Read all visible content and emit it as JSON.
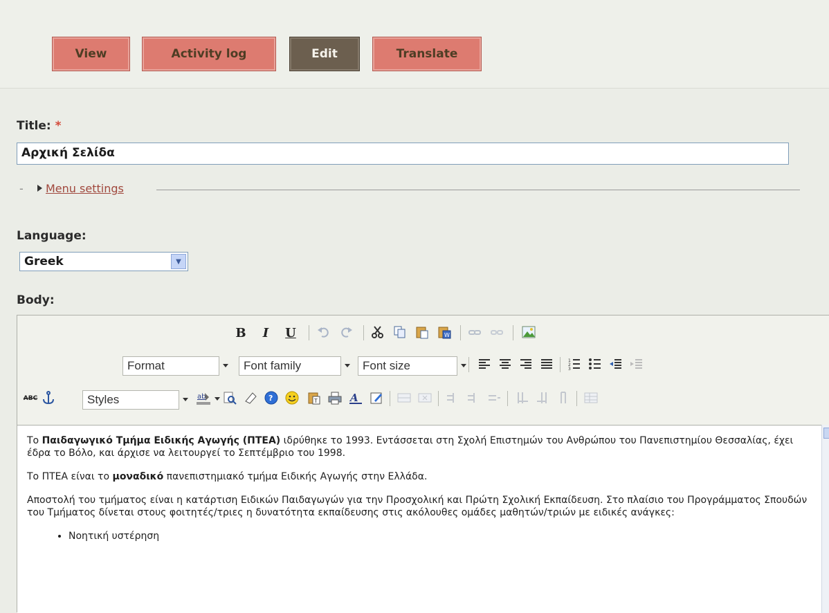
{
  "tabs": {
    "view": "View",
    "activity_log": "Activity log",
    "edit": "Edit",
    "translate": "Translate"
  },
  "title_field": {
    "label": "Title:",
    "required_mark": "*",
    "value": "Αρχική Σελίδα"
  },
  "menu_settings": {
    "link": "Menu settings",
    "dash": "-"
  },
  "language": {
    "label": "Language:",
    "selected": "Greek"
  },
  "body": {
    "label": "Body:",
    "toolbar": {
      "bold": "B",
      "italic": "I",
      "underline": "U",
      "format": "Format",
      "font_family": "Font family",
      "font_size": "Font size",
      "styles": "Styles",
      "spellcheck": "ABC"
    },
    "content": {
      "p1_pre": "Το ",
      "p1_bold": "Παιδαγωγικό Τμήμα Ειδικής Αγωγής (ΠΤΕΑ)",
      "p1_post": " ιδρύθηκε το 1993. Εντάσσεται στη Σχολή Επιστημών του Ανθρώπου του Πανεπιστημίου Θεσσαλίας, έχει έδρα το Βόλο, και άρχισε να λειτουργεί το Σεπτέμβριο του 1998.",
      "p2_pre": "Το ΠΤΕΑ είναι το ",
      "p2_bold": "μοναδικό",
      "p2_post": " πανεπιστημιακό τμήμα Ειδικής Αγωγής στην Ελλάδα.",
      "p3": "Αποστολή του τμήματος είναι η κατάρτιση Ειδικών Παιδαγωγών για την Προσχολική και Πρώτη Σχολική Εκπαίδευση. Στο πλαίσιο του Προγράμματος Σπουδών του Τμήματος δίνεται στους φοιτητές/τριες η δυνατότητα εκπαίδευσης στις ακόλουθες ομάδες μαθητών/τριών με ειδικές ανάγκες:",
      "list": [
        "Νοητική υστέρηση"
      ]
    }
  },
  "colors": {
    "tab": "#dd7b70",
    "tab_active": "#6c5f4f",
    "link": "#a0483d",
    "page_bg": "#ebede7"
  }
}
